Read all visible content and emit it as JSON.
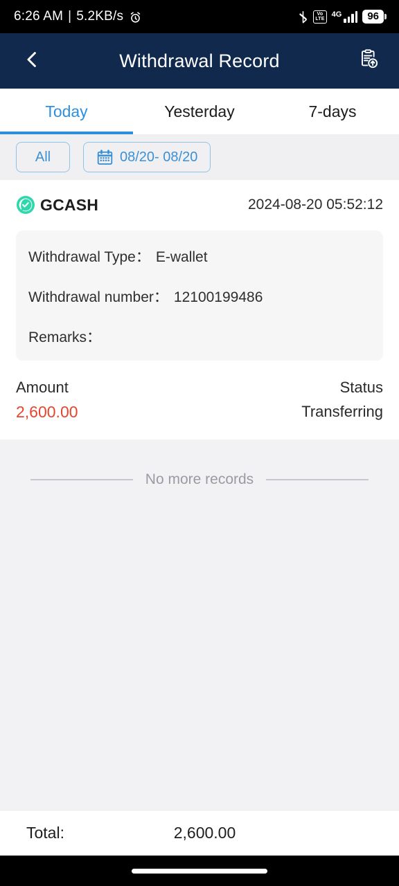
{
  "status_bar": {
    "time": "6:26 AM",
    "separator": "|",
    "network_speed": "5.2KB/s",
    "alarm_icon": "alarm-icon",
    "bluetooth_icon": "bluetooth-icon",
    "volte_label": "VoLTE",
    "network_type": "4G",
    "signal_icon": "signal-bars-icon",
    "battery_level": "96"
  },
  "header": {
    "back_icon": "chevron-left-icon",
    "title": "Withdrawal Record",
    "action_icon": "clipboard-upload-icon",
    "background": "#10294d"
  },
  "tabs": {
    "active_index": 0,
    "accent": "#2e8fdd",
    "items": [
      {
        "label": "Today"
      },
      {
        "label": "Yesterday"
      },
      {
        "label": "7-days"
      }
    ]
  },
  "filters": {
    "all_label": "All",
    "calendar_icon": "calendar-icon",
    "date_range": "08/20- 08/20"
  },
  "records": [
    {
      "brand_icon": "gcash-icon",
      "brand": "GCASH",
      "timestamp": "2024-08-20 05:52:12",
      "details": [
        {
          "label": "Withdrawal Type：",
          "value": "E-wallet"
        },
        {
          "label": "Withdrawal number：",
          "value": "12100199486"
        },
        {
          "label": "Remarks：",
          "value": ""
        }
      ],
      "amount_label": "Amount",
      "amount_value": "2,600.00",
      "amount_color": "#e8452c",
      "status_label": "Status",
      "status_value": "Transferring"
    }
  ],
  "list_footer": {
    "text": "No more records"
  },
  "total_bar": {
    "label": "Total:",
    "value": "2,600.00"
  }
}
